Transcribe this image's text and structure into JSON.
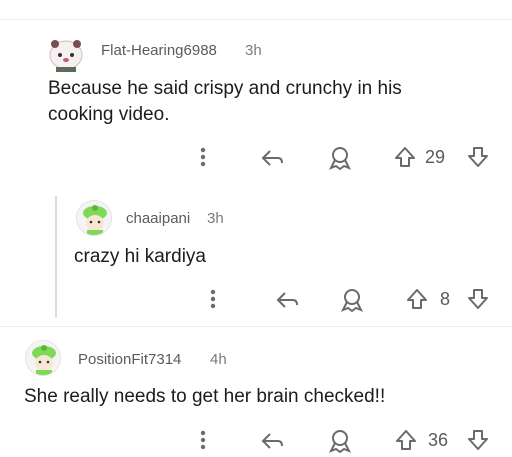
{
  "comments": [
    {
      "username": "Flat-Hearing6988",
      "time": "3h",
      "text": "Because he said crispy and crunchy in his cooking video.",
      "votes": "29",
      "avatar": "panda-avatar"
    },
    {
      "username": "chaaipani",
      "time": "3h",
      "text": "crazy hi kardiya",
      "votes": "8",
      "avatar": "green-hat-avatar"
    },
    {
      "username": "PositionFit7314",
      "time": "4h",
      "text": "She really needs to get her brain checked!!",
      "votes": "36",
      "avatar": "green-hat-avatar"
    }
  ],
  "icons": {
    "more": "more-vertical-icon",
    "reply": "reply-arrow-icon",
    "award": "award-icon",
    "upvote": "upvote-arrow-icon",
    "downvote": "downvote-arrow-icon"
  },
  "colors": {
    "text": "#1c1c1c",
    "meta": "#7b7b7b",
    "icon": "#6a6a6a",
    "thread_line": "#dcdcdc",
    "avatar_green": "#7ed957"
  }
}
